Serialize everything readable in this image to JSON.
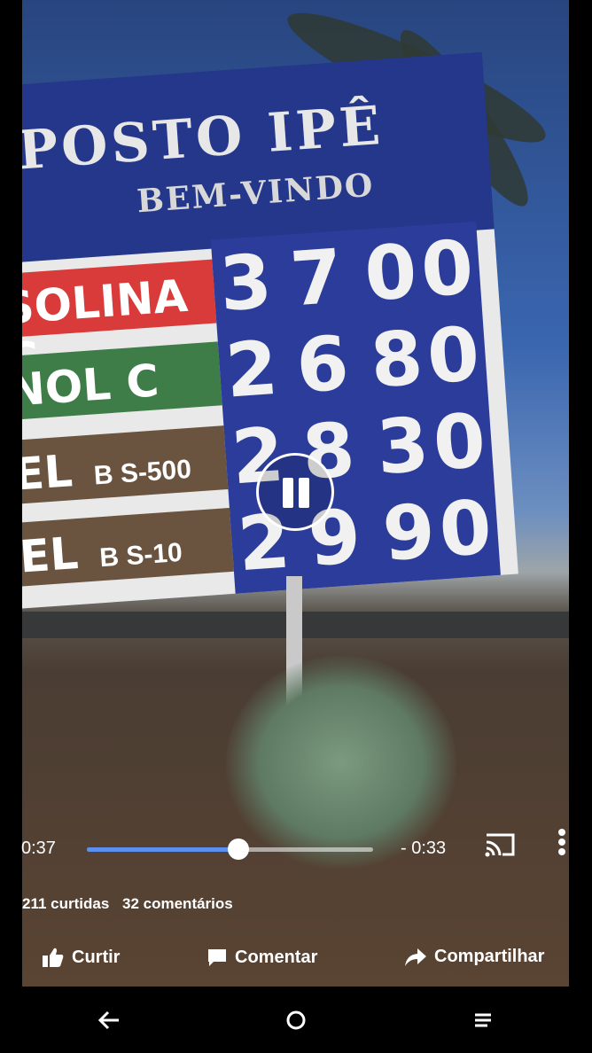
{
  "video": {
    "sign": {
      "title": "POSTO IPÊ",
      "subtitle": "BEM-VINDO",
      "fuels": [
        {
          "label": "SOLINA C",
          "sub": "",
          "digits": [
            "3",
            "7",
            "0",
            "0"
          ]
        },
        {
          "label": "NOL C",
          "sub": "",
          "digits": [
            "2",
            "6",
            "8",
            "0"
          ]
        },
        {
          "label": "EL",
          "sub": "B S-500",
          "digits": [
            "2",
            "8",
            "3",
            "0"
          ]
        },
        {
          "label": "EL",
          "sub": "B S-10",
          "digits": [
            "2",
            "9",
            "9",
            "0"
          ]
        }
      ]
    }
  },
  "player": {
    "elapsed": "0:37",
    "remaining": "- 0:33",
    "progress": 0.53
  },
  "stats": {
    "likes": "211 curtidas",
    "comments": "32 comentários"
  },
  "actions": {
    "like": "Curtir",
    "comment": "Comentar",
    "share": "Compartilhar"
  },
  "colors": {
    "progress_fill": "#5b8ff0",
    "sign_blue": "#24378b",
    "gas_red": "#d93b3b",
    "ethanol_green": "#3e7d47",
    "diesel_brown": "#6a5440"
  }
}
